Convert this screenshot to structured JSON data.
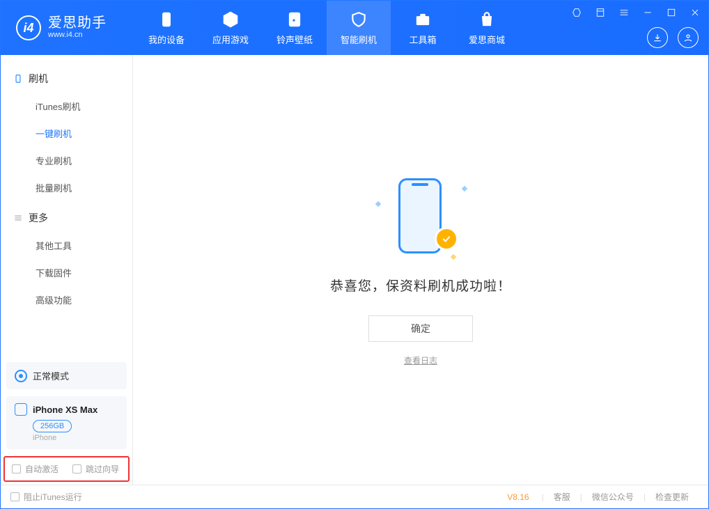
{
  "app": {
    "title": "爱思助手",
    "subtitle": "www.i4.cn"
  },
  "tabs": {
    "device": "我的设备",
    "apps": "应用游戏",
    "ringtones": "铃声壁纸",
    "flash": "智能刷机",
    "toolbox": "工具箱",
    "store": "爱思商城"
  },
  "sidebar": {
    "section_flash": "刷机",
    "items_flash": {
      "itunes": "iTunes刷机",
      "onekey": "一键刷机",
      "pro": "专业刷机",
      "batch": "批量刷机"
    },
    "section_more": "更多",
    "items_more": {
      "other": "其他工具",
      "firmware": "下载固件",
      "advanced": "高级功能"
    }
  },
  "device": {
    "mode": "正常模式",
    "name": "iPhone XS Max",
    "capacity": "256GB",
    "type": "iPhone"
  },
  "options": {
    "auto_activate": "自动激活",
    "skip_guide": "跳过向导"
  },
  "main": {
    "headline": "恭喜您，保资料刷机成功啦！",
    "ok": "确定",
    "view_log": "查看日志"
  },
  "footer": {
    "block_itunes": "阻止iTunes运行",
    "version": "V8.16",
    "support": "客服",
    "wechat": "微信公众号",
    "update": "检查更新"
  }
}
